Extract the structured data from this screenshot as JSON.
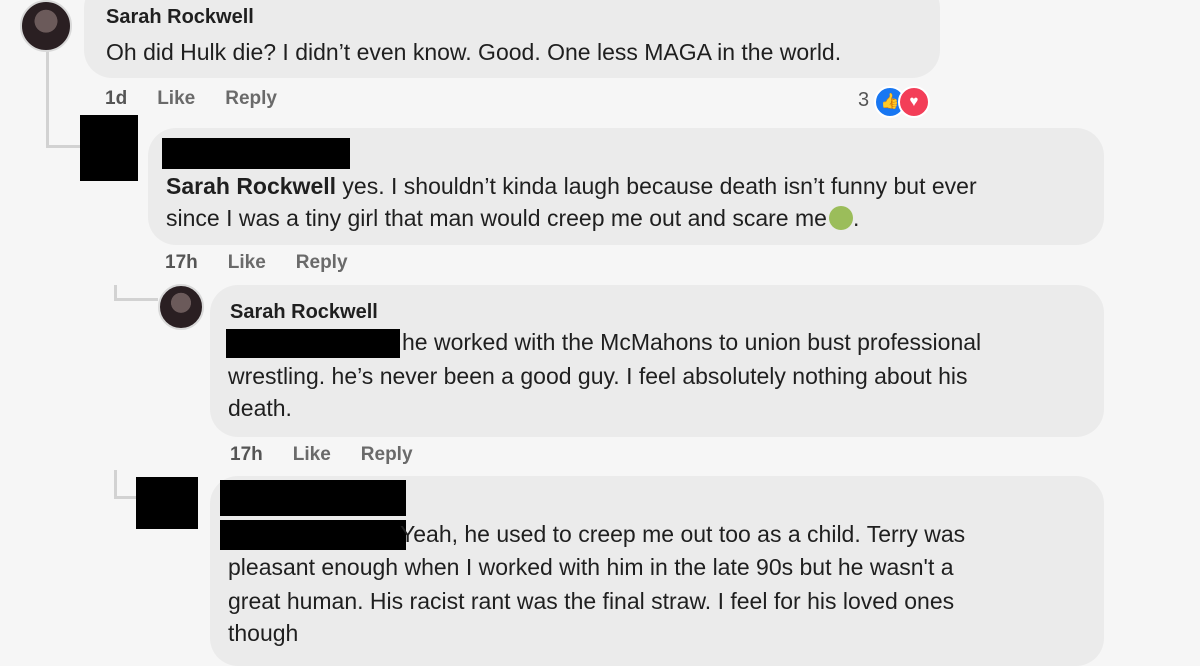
{
  "comments": [
    {
      "author": "Sarah Rockwell",
      "text": "Oh did Hulk die? I didn’t even know. Good. One less MAGA in the world.",
      "time": "1d",
      "like": "Like",
      "reply": "Reply",
      "reaction_count": "3"
    },
    {
      "mention": "Sarah Rockwell",
      "text_line1": " yes. I shouldn’t kinda laugh because death isn’t funny but ever",
      "text_line2": "since I was a tiny girl that man would creep me out and scare me",
      "text_end": ".",
      "time": "17h",
      "like": "Like",
      "reply": "Reply"
    },
    {
      "author": "Sarah Rockwell",
      "text_line1": "he worked with the McMahons to union bust professional",
      "text_line2": "wrestling. he’s never been a good guy. I feel absolutely nothing about his",
      "text_line3": "death.",
      "time": "17h",
      "like": "Like",
      "reply": "Reply"
    },
    {
      "text_line1": "Yeah, he used to creep me out too as a child. Terry was",
      "text_line2": "pleasant enough when I worked with him in the late 90s but he wasn't a",
      "text_line3": "great human. His racist rant was the final straw. I feel for his loved ones",
      "text_line4": "though"
    }
  ],
  "colors": {
    "bubble": "#ebebeb",
    "like_blue": "#1877f2",
    "love_red": "#f33e58"
  }
}
